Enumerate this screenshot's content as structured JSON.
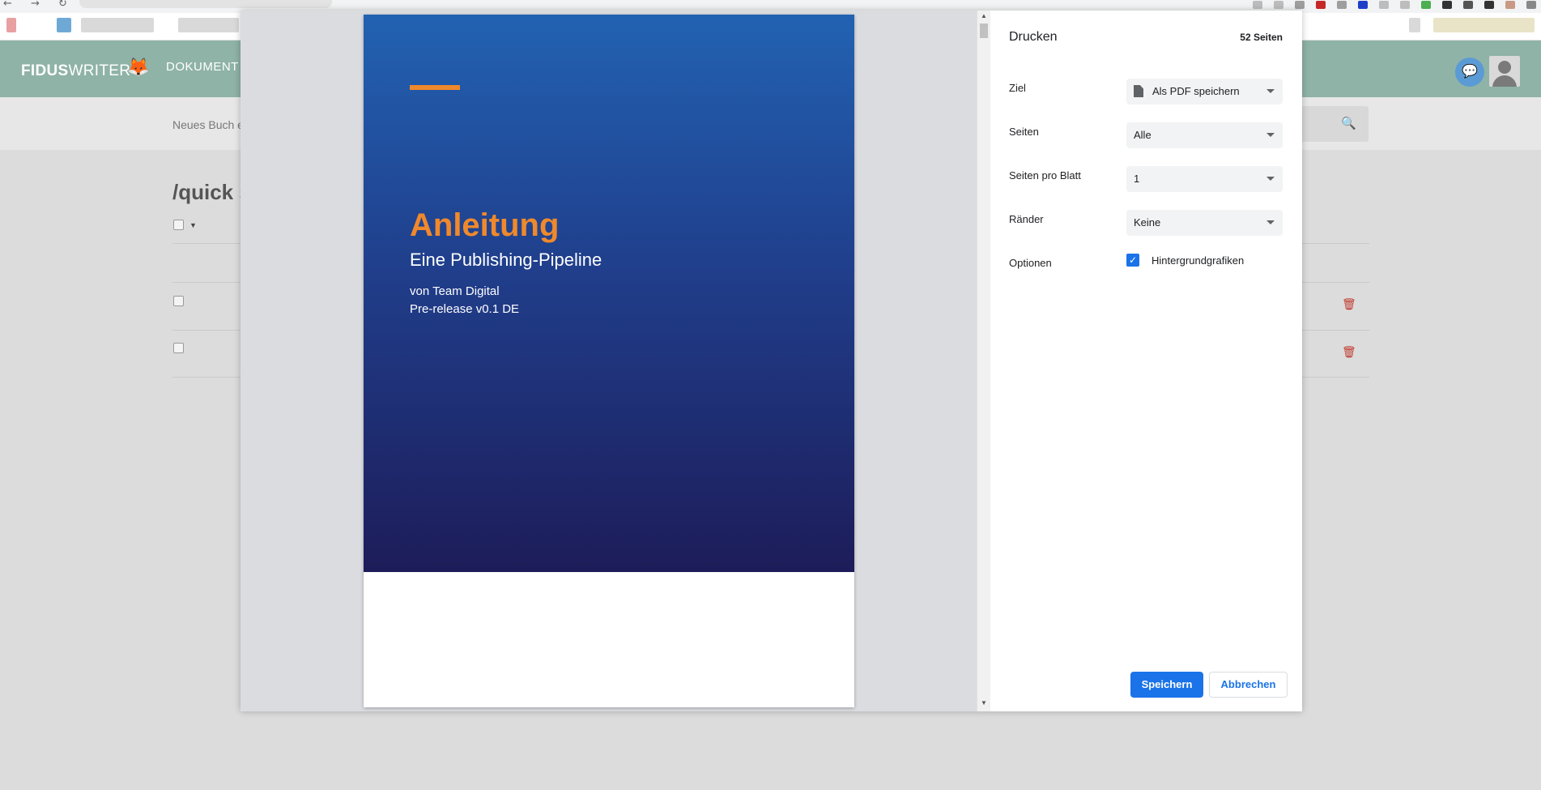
{
  "browser": {
    "back_icon": "arrow-left-icon",
    "forward_icon": "arrow-right-icon",
    "reload_icon": "reload-icon"
  },
  "app": {
    "logo_bold": "FIDUS",
    "logo_light": "WRITER",
    "nav_item": "DOKUMENT",
    "new_book": "Neues Buch e",
    "page_title": "/quick s",
    "brand_color": "#8fb3a6"
  },
  "print": {
    "title": "Drucken",
    "page_count": "52 Seiten",
    "rows": {
      "destination": {
        "label": "Ziel",
        "value": "Als PDF speichern"
      },
      "pages": {
        "label": "Seiten",
        "value": "Alle"
      },
      "pages_per_sheet": {
        "label": "Seiten pro Blatt",
        "value": "1"
      },
      "margins": {
        "label": "Ränder",
        "value": "Keine"
      },
      "options": {
        "label": "Optionen",
        "checkbox_label": "Hintergrundgrafiken",
        "checked": true
      }
    },
    "save_button": "Speichern",
    "cancel_button": "Abbrechen",
    "accent_color": "#1a73e8"
  },
  "preview": {
    "cover_title": "Anleitung",
    "cover_subtitle": "Eine Publishing-Pipeline",
    "cover_author": "von Team Digital",
    "cover_version": "Pre-release v0.1 DE",
    "title_color": "#f0892b"
  }
}
